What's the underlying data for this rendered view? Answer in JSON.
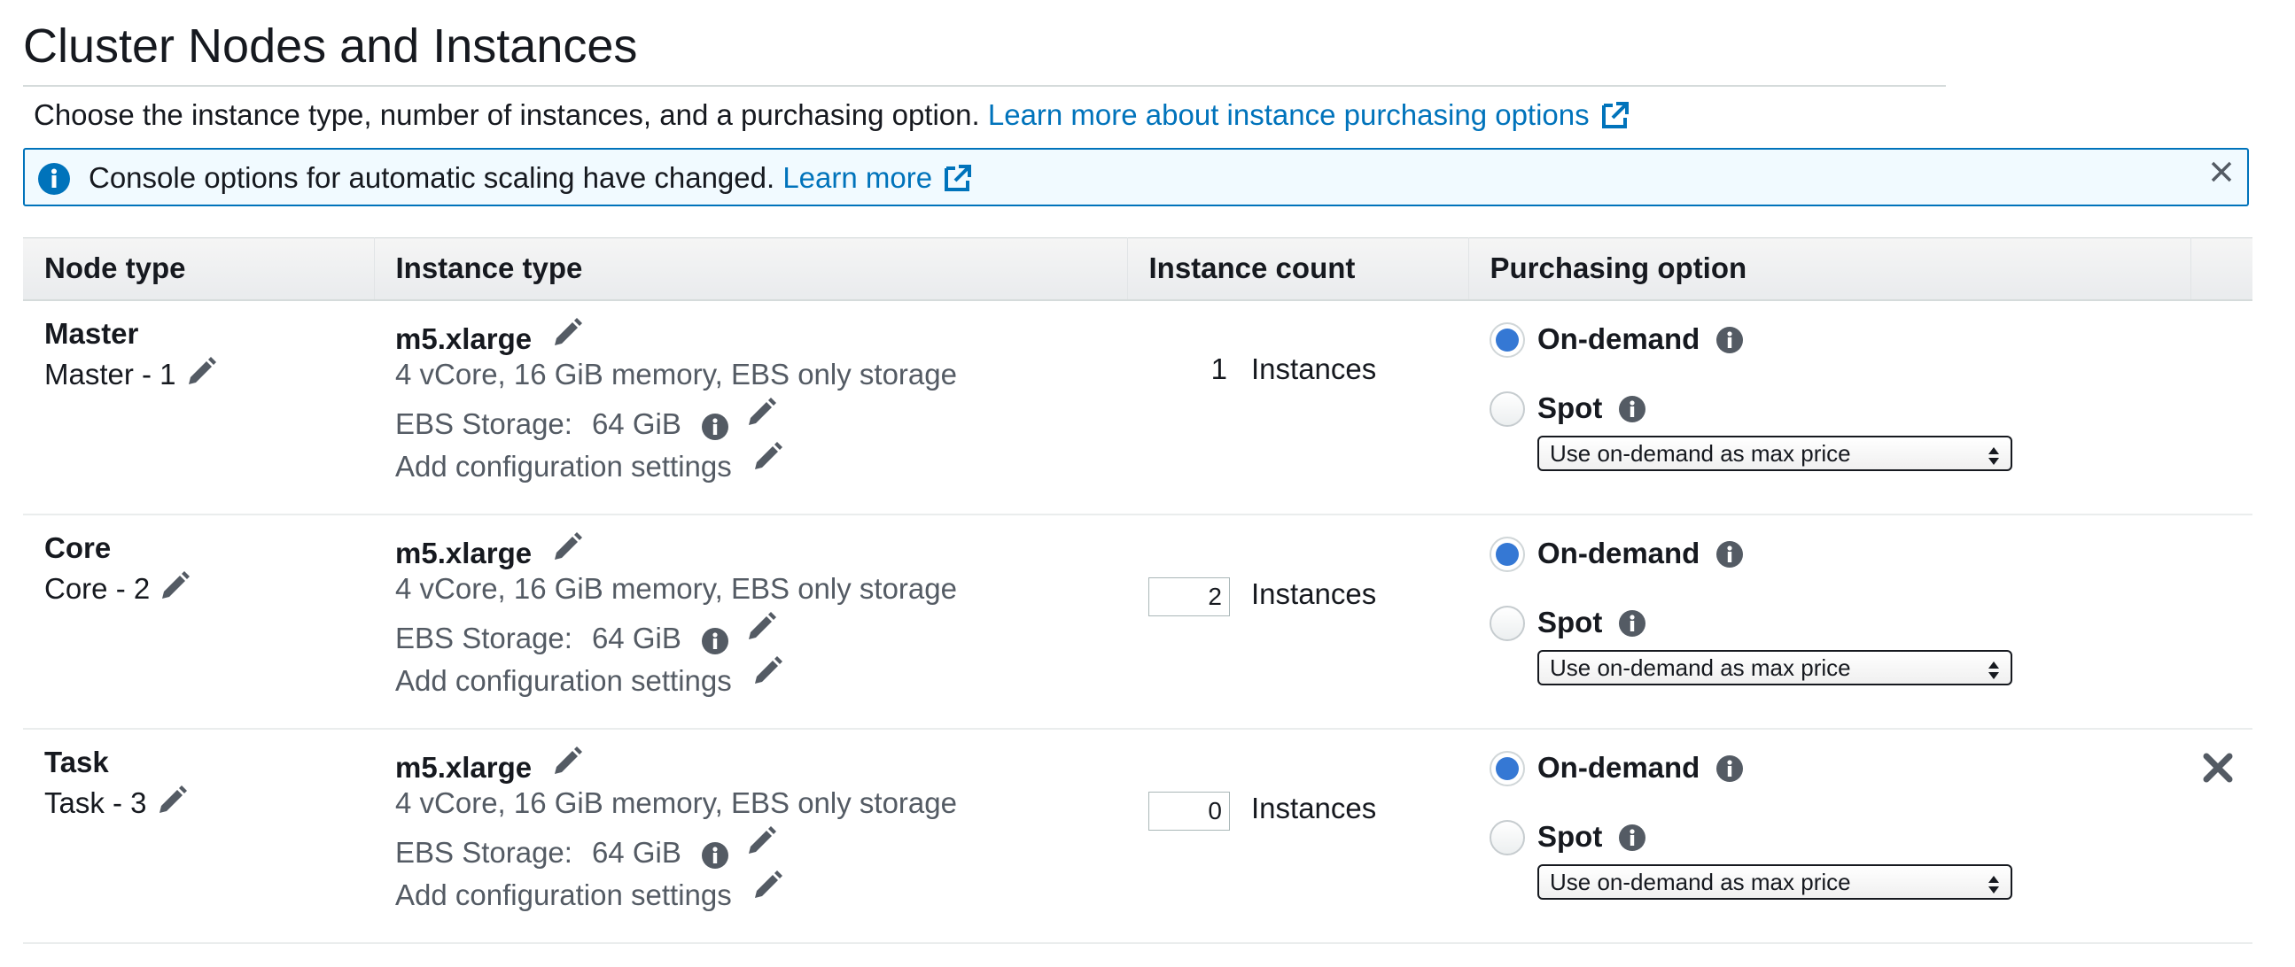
{
  "section": {
    "title": "Cluster Nodes and Instances",
    "description": "Choose the instance type, number of instances, and a purchasing option.",
    "learn_more_purchasing": "Learn more about instance purchasing options"
  },
  "banner": {
    "message": "Console options for automatic scaling have changed.",
    "learn_more": "Learn more"
  },
  "table": {
    "headers": {
      "node_type": "Node type",
      "instance_type": "Instance type",
      "instance_count": "Instance count",
      "purchasing_option": "Purchasing option"
    },
    "rows": [
      {
        "node_type": "Master",
        "node_label": "Master - 1",
        "instance_type": "m5.xlarge",
        "spec": "4 vCore, 16 GiB memory, EBS only storage",
        "ebs_label": "EBS Storage:",
        "ebs_value": "64 GiB",
        "add_config": "Add configuration settings",
        "count": "1",
        "count_unit": "Instances",
        "on_demand": "On-demand",
        "spot": "Spot",
        "max_price": "Use on-demand as max price"
      },
      {
        "node_type": "Core",
        "node_label": "Core - 2",
        "instance_type": "m5.xlarge",
        "spec": "4 vCore, 16 GiB memory, EBS only storage",
        "ebs_label": "EBS Storage:",
        "ebs_value": "64 GiB",
        "add_config": "Add configuration settings",
        "count": "2",
        "count_unit": "Instances",
        "on_demand": "On-demand",
        "spot": "Spot",
        "max_price": "Use on-demand as max price"
      },
      {
        "node_type": "Task",
        "node_label": "Task - 3",
        "instance_type": "m5.xlarge",
        "spec": "4 vCore, 16 GiB memory, EBS only storage",
        "ebs_label": "EBS Storage:",
        "ebs_value": "64 GiB",
        "add_config": "Add configuration settings",
        "count": "0",
        "count_unit": "Instances",
        "on_demand": "On-demand",
        "spot": "Spot",
        "max_price": "Use on-demand as max price"
      }
    ]
  },
  "colors": {
    "link": "#0073bb",
    "banner_border": "#0073bb",
    "radio_selected": "#3578d4",
    "secondary_text": "#545b64"
  },
  "icons": [
    "info-icon",
    "external-link-icon",
    "close-icon",
    "pencil-icon",
    "remove-icon",
    "select-arrows-icon"
  ]
}
